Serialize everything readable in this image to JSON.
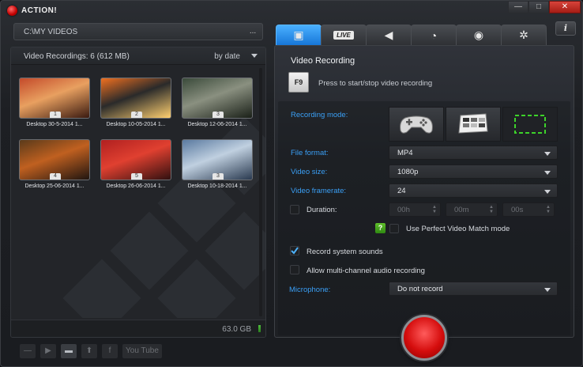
{
  "app": {
    "title": "ACTION!"
  },
  "window_controls": {
    "minimize": "—",
    "maximize": "□",
    "close": "✕"
  },
  "path": {
    "value": "C:\\MY VIDEOS",
    "browse_label": "..."
  },
  "recordings": {
    "count_label": "Video Recordings: 6 (612 MB)",
    "sort_label": "by date",
    "items": [
      {
        "label": "Desktop 30-5-2014 1...",
        "number": "1",
        "colors": [
          "#c44a2a",
          "#e8a060",
          "#3a1a10"
        ]
      },
      {
        "label": "Desktop 10-05-2014 1...",
        "number": "2",
        "colors": [
          "#f07020",
          "#2a2a2a",
          "#ffd070"
        ]
      },
      {
        "label": "Desktop 12-06-2014 1...",
        "number": "3",
        "colors": [
          "#3a4a3a",
          "#8a9080",
          "#1a2018"
        ]
      },
      {
        "label": "Desktop 25-06-2014 1...",
        "number": "4",
        "colors": [
          "#5a3a1a",
          "#c06020",
          "#201510"
        ]
      },
      {
        "label": "Desktop 26-06-2014 1...",
        "number": "5",
        "colors": [
          "#b02020",
          "#e04030",
          "#301010"
        ]
      },
      {
        "label": "Desktop 10-18-2014 1...",
        "number": "3",
        "colors": [
          "#5a7aa0",
          "#c0d0e0",
          "#2a3a50"
        ]
      }
    ],
    "free_space": "63.0 GB"
  },
  "bottom_toolbar": {
    "items": [
      {
        "name": "remove",
        "glyph": "—"
      },
      {
        "name": "play",
        "glyph": "▶"
      },
      {
        "name": "folder",
        "glyph": "▬"
      },
      {
        "name": "upload",
        "glyph": "⬆"
      },
      {
        "name": "facebook",
        "glyph": "f"
      },
      {
        "name": "youtube",
        "glyph": "You Tube"
      }
    ]
  },
  "tabs": [
    {
      "name": "video-recording",
      "glyph": "▣",
      "active": true
    },
    {
      "name": "live",
      "glyph": "LIVE",
      "active": false
    },
    {
      "name": "audio",
      "glyph": "◀",
      "active": false
    },
    {
      "name": "timer",
      "glyph": "◔",
      "active": false
    },
    {
      "name": "screenshot",
      "glyph": "◉",
      "active": false
    },
    {
      "name": "settings",
      "glyph": "✲",
      "active": false
    }
  ],
  "info_label": "i",
  "video": {
    "title": "Video Recording",
    "hotkey": "F9",
    "hotkey_desc": "Press to start/stop video recording",
    "recording_mode_label": "Recording mode:",
    "file_format_label": "File format:",
    "file_format": "MP4",
    "video_size_label": "Video size:",
    "video_size": "1080p",
    "framerate_label": "Video framerate:",
    "framerate": "24",
    "duration_label": "Duration:",
    "duration_h": "00h",
    "duration_m": "00m",
    "duration_s": "00s",
    "perfect_match_label": "Use Perfect Video Match mode",
    "help_glyph": "?",
    "record_system_label": "Record system sounds",
    "record_system_checked": true,
    "multichannel_label": "Allow multi-channel audio recording",
    "multichannel_checked": false,
    "microphone_label": "Microphone:",
    "microphone": "Do not record"
  },
  "colors": {
    "accent": "#2f9bf7",
    "record": "#d50d0d",
    "bg": "#1d1f23"
  }
}
